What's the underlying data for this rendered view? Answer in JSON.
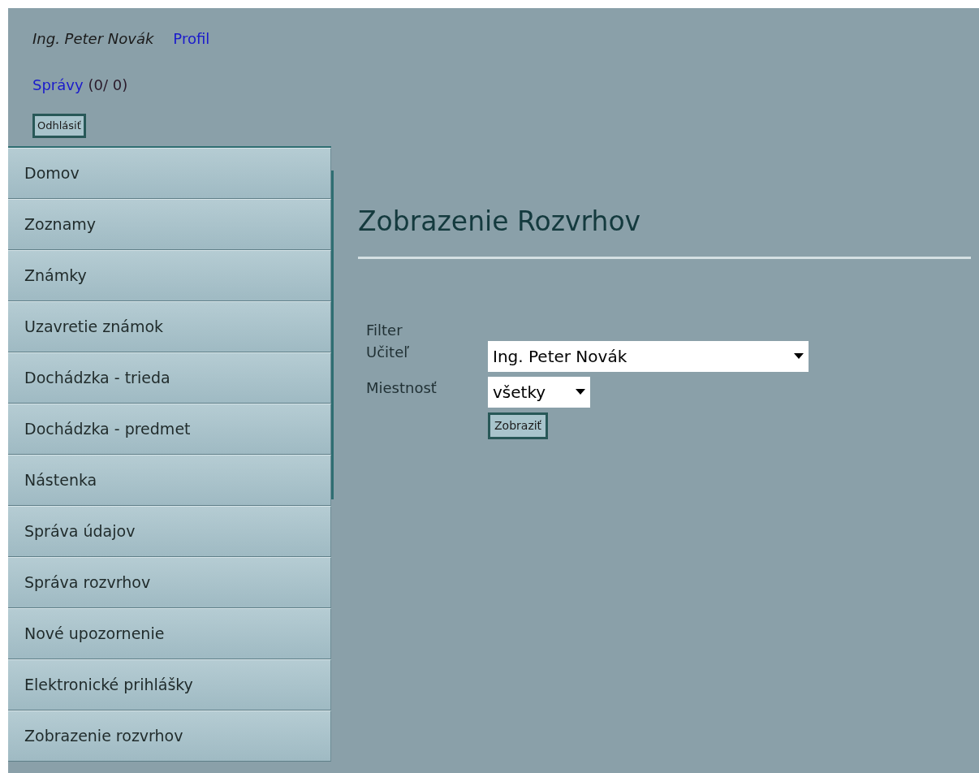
{
  "user": {
    "name": "Ing. Peter Novák",
    "profile_link": "Profil"
  },
  "messages": {
    "link": "Správy",
    "count": "(0/ 0)"
  },
  "logout_button": "Odhlásiť",
  "menu": [
    "Domov",
    "Zoznamy",
    "Známky",
    "Uzavretie známok",
    "Dochádzka - trieda",
    "Dochádzka - predmet",
    "Nástenka",
    "Správa údajov",
    "Správa rozvrhov",
    "Nové upozornenie",
    "Elektronické prihlášky",
    "Zobrazenie rozvrhov"
  ],
  "page_title": "Zobrazenie Rozvrhov",
  "filter": {
    "heading": "Filter",
    "fields": [
      {
        "label": "Učiteľ",
        "value": "Ing. Peter Novák",
        "wide": true
      },
      {
        "label": "Miestnosť",
        "value": "všetky",
        "wide": false
      }
    ],
    "submit": "Zobraziť"
  }
}
